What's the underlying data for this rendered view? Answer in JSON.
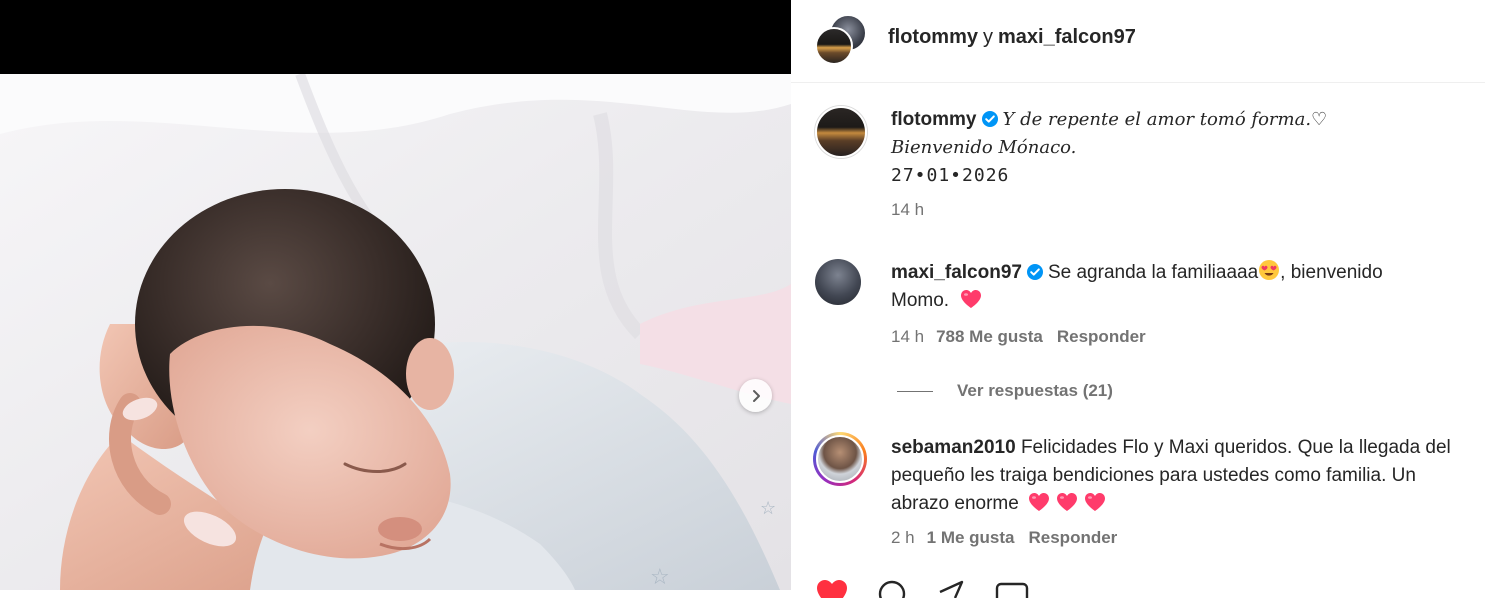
{
  "header": {
    "user1": "flotommy",
    "connector": "y",
    "user2": "maxi_falcon97"
  },
  "caption": {
    "username": "flotommy",
    "text_line1": "Y de repente el amor tomó forma.♡",
    "text_line2": "Bienvenido Mónaco.",
    "date": "27•01•2026",
    "time": "14 h"
  },
  "comments": [
    {
      "username": "maxi_falcon97",
      "text_a": "Se agranda la familiaaaa",
      "text_b": ", bienvenido",
      "text_c": "Momo.",
      "time": "14 h",
      "likes": "788 Me gusta",
      "reply": "Responder",
      "view_replies": "Ver respuestas (21)"
    },
    {
      "username": "sebaman2010",
      "text_a": "Felicidades Flo y Maxi queridos. Que la llegada del pequeño les traiga bendiciones para ustedes como familia. Un abrazo enorme",
      "time": "2 h",
      "likes": "1 Me gusta",
      "reply": "Responder"
    }
  ],
  "colors": {
    "verified": "#0095f6",
    "heart": "#ff3b6b",
    "secondary_text": "#737373",
    "story_ring": "#d62976"
  },
  "icons": {
    "verified": "verified-badge-icon",
    "next": "chevron-right-icon",
    "heart_emoji": "pink-heart-emoji",
    "heart_eyes_emoji": "heart-eyes-emoji"
  }
}
